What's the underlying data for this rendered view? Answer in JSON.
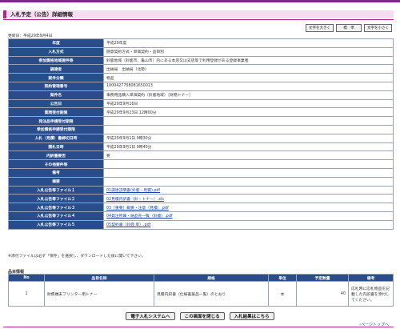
{
  "header": {
    "title": "入札予定（公告）詳細情報"
  },
  "font_buttons": {
    "larger": "文字を大きく",
    "standard": "標　準",
    "smaller": "文字を小さく"
  },
  "updated": "更新日：平成29年9月4日",
  "detail_rows": [
    {
      "label": "年度",
      "value": "平成29年度"
    },
    {
      "label": "入札方式",
      "value": "随意契約方式・単価契約・品目別"
    },
    {
      "label": "参加資格地域要件等",
      "value": "鈴鹿地域（鈴鹿市、亀山市）内にある本店又は支店等で利用登録がある登録事業者"
    },
    {
      "label": "調達者",
      "value": "出納局　出納局（北勢）"
    },
    {
      "label": "案件分類",
      "value": "物品"
    },
    {
      "label": "契約管理番号",
      "value": "1000427708081650013"
    },
    {
      "label": "案件名",
      "value": "事務用品購入単価契約（鈴鹿地域）［財務トナー］"
    },
    {
      "label": "公告日",
      "value": "平成29年9月16日"
    },
    {
      "label": "質問受付期限",
      "value": "平成29年9月23日 12時00分"
    },
    {
      "label": "発注品申請受付期限",
      "value": ""
    },
    {
      "label": "参加資格申請受付期限",
      "value": ""
    },
    {
      "label": "入札（見積）書締切日時",
      "value": "平成29年9月1日 9時30分"
    },
    {
      "label": "開札日時",
      "value": "平成29年9月1日 9時40分"
    },
    {
      "label": "内訳書要否",
      "value": "要"
    },
    {
      "label": "その他要件等",
      "value": ""
    },
    {
      "label": "備考",
      "value": ""
    },
    {
      "label": "摘要",
      "value": ""
    }
  ],
  "file_rows": [
    {
      "label": "入札公告等ファイル１",
      "link": "01調達説明書(鈴鹿・見積).pdf"
    },
    {
      "label": "入札公告等ファイル２",
      "link": "02見積内訳書（鈴・トナー）.xls"
    },
    {
      "label": "入札公告等ファイル３",
      "link": "03［重要］概要・注意（見積）.pdf"
    },
    {
      "label": "入札公告等ファイル４",
      "link": "04発注所属・納品先一覧（鈴鹿）.pdf"
    },
    {
      "label": "入札公告等ファイル５",
      "link": "05契約書（鈴鹿 単）.pdf"
    }
  ],
  "note": "※添付ファイルは必ず「保存」を選択し、ダウンロードした後に開いて下さい。",
  "items_section": {
    "title": "品目情報",
    "headers": [
      "No",
      "品目名称",
      "規格",
      "単位",
      "予定数量",
      "備考"
    ],
    "rows": [
      {
        "no": "1",
        "name": "財務端末プリンター用トナー",
        "spec": "見積内訳書（仕様書兼品一覧）のとおり",
        "unit": "本",
        "qty": "40",
        "remarks": "応札時に応札物品を記載した内訳書を添付してください。"
      }
    ]
  },
  "bottom_buttons": {
    "system": "電子入札システムへ",
    "close": "この画面を閉じる",
    "results": "入札結果はこちら"
  },
  "page_top": "ページトップへ"
}
